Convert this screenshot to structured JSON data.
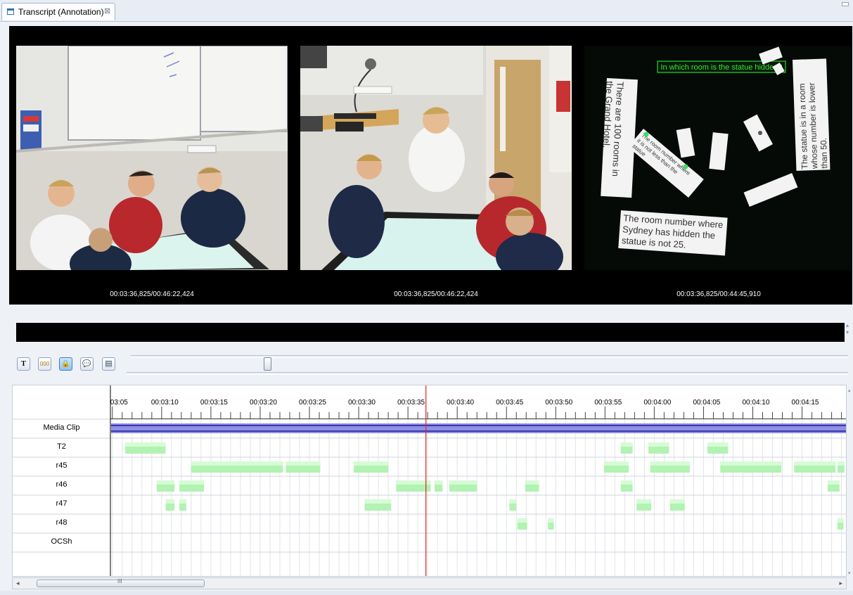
{
  "tab": {
    "title": "Transcript (Annotation)",
    "close_glyph": "⊠"
  },
  "videos": [
    {
      "time": "00:03:36,825/00:46:22,424"
    },
    {
      "time": "00:03:36,825/00:46:22,424"
    },
    {
      "time": "00:03:36,825/00:44:45,910",
      "screen_question": "In which room is the statue hidden?",
      "card_1": [
        "There are 100 rooms in",
        "the Grand Hotel."
      ],
      "card_2": [
        "The statue is in a room",
        "whose number is lower",
        "than 50."
      ],
      "card_3": [
        "The room number where",
        "Sydney has hidden the",
        "statue is not 25."
      ],
      "card_4": [
        "The room number where",
        "it is not less than the",
        "statue"
      ]
    }
  ],
  "toolbar": {
    "buttons": [
      {
        "glyph": "T",
        "icon": "text-mode-icon",
        "active": false
      },
      {
        "glyph": "000",
        "icon": "counter-icon",
        "active": false
      },
      {
        "glyph": "🔒",
        "icon": "lock-icon",
        "active": true
      },
      {
        "glyph": "💬",
        "icon": "speech-bubble-icon",
        "active": false
      },
      {
        "glyph": "▤",
        "icon": "save-icon",
        "active": false
      }
    ],
    "slider_value": 0.19
  },
  "timeline": {
    "time_labels": [
      "03:05",
      "00:03:10",
      "00:03:15",
      "00:03:20",
      "00:03:25",
      "00:03:30",
      "00:03:35",
      "00:03:40",
      "00:03:45",
      "00:03:50",
      "00:03:55",
      "00:04:00",
      "00:04:05",
      "00:04:10",
      "00:04:15"
    ],
    "view_start_s": 184.8,
    "view_end_s": 259.6,
    "cursor_s": 216.825,
    "tiers": [
      {
        "name": "Media Clip",
        "segments": [
          [
            184.8,
            259.6
          ]
        ]
      },
      {
        "name": "T2",
        "segments": [
          [
            186.3,
            190.4
          ],
          [
            236.6,
            237.8
          ],
          [
            239.4,
            241.5
          ],
          [
            245.4,
            247.5
          ]
        ]
      },
      {
        "name": "r45",
        "segments": [
          [
            193.0,
            202.3
          ],
          [
            202.6,
            206.1
          ],
          [
            209.5,
            213.0
          ],
          [
            234.9,
            237.4
          ],
          [
            239.6,
            243.6
          ],
          [
            246.7,
            252.9
          ],
          [
            254.2,
            258.4
          ],
          [
            258.6,
            259.3
          ]
        ]
      },
      {
        "name": "r46",
        "segments": [
          [
            189.5,
            191.3
          ],
          [
            191.8,
            194.3
          ],
          [
            213.8,
            217.3
          ],
          [
            217.7,
            218.5
          ],
          [
            219.2,
            222.0
          ],
          [
            226.9,
            228.3
          ],
          [
            236.6,
            237.8
          ],
          [
            257.6,
            258.8
          ]
        ]
      },
      {
        "name": "r47",
        "segments": [
          [
            190.4,
            191.3
          ],
          [
            191.8,
            192.5
          ],
          [
            210.6,
            213.3
          ],
          [
            225.3,
            226.0
          ],
          [
            238.2,
            239.7
          ],
          [
            241.6,
            243.1
          ]
        ]
      },
      {
        "name": "r48",
        "segments": [
          [
            226.1,
            227.1
          ],
          [
            229.2,
            229.8
          ],
          [
            258.6,
            259.2
          ]
        ]
      },
      {
        "name": "OCSh",
        "segments": []
      }
    ]
  },
  "scrollbar": {
    "thumb_grip": "III",
    "left_arrow": "◂",
    "right_arrow": "▸"
  },
  "colors": {
    "segment_fill": "#b2f2b2",
    "segment_fill_top": "#d6fbd6",
    "cursor": "#e02020",
    "media_clip_bar": "#9090e8",
    "media_clip_line": "#3a3aa8",
    "grid": "#e2e4e8"
  }
}
